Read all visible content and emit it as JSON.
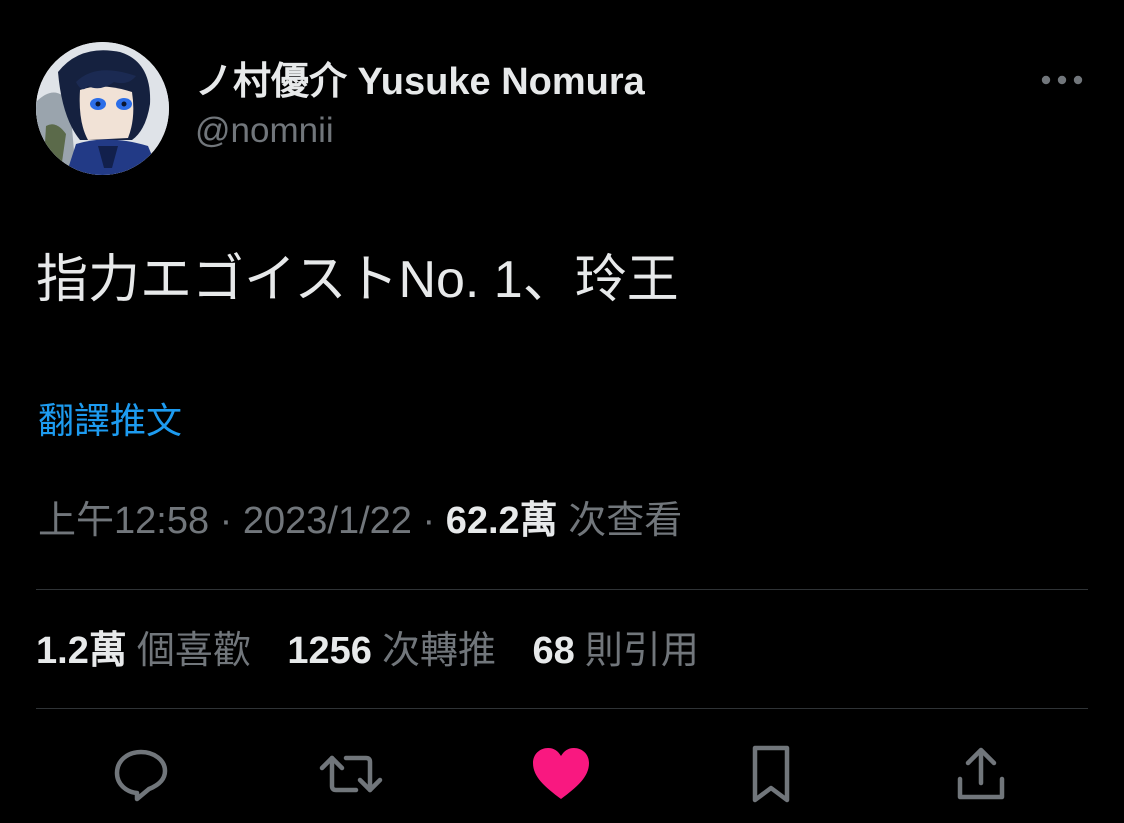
{
  "author": {
    "display_name": "ノ村優介 Yusuke Nomura",
    "handle": "@nomnii",
    "avatar_icon": "user-avatar-icon"
  },
  "tweet": {
    "text": "指力エゴイストNo. 1、玲王",
    "translate_label": "翻譯推文"
  },
  "meta": {
    "time": "上午12:58",
    "separator": " · ",
    "date": "2023/1/22",
    "views_count": "62.2萬",
    "views_label": "次查看"
  },
  "stats": {
    "likes_count": "1.2萬",
    "likes_label": "個喜歡",
    "retweets_count": "1256",
    "retweets_label": "次轉推",
    "quotes_count": "68",
    "quotes_label": "則引用"
  },
  "actions": {
    "reply_icon": "reply-icon",
    "retweet_icon": "retweet-icon",
    "like_icon": "heart-icon",
    "bookmark_icon": "bookmark-icon",
    "share_icon": "share-icon",
    "more_icon": "more-horizontal-icon"
  },
  "colors": {
    "background": "#000000",
    "primary_text": "#e7e9ea",
    "secondary_text": "#71767b",
    "link": "#1d9bf0",
    "like_active": "#f91880",
    "divider": "#2f3336"
  }
}
